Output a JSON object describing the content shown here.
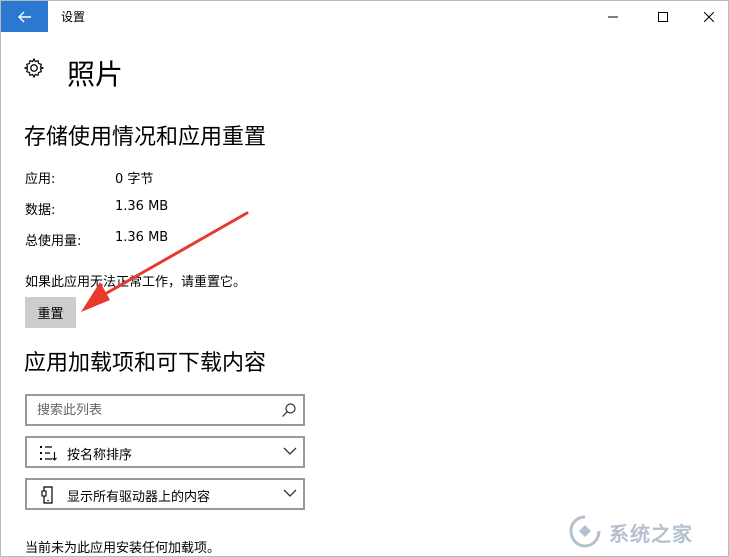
{
  "window": {
    "title": "设置",
    "accent_color": "#2b78d0"
  },
  "page": {
    "title": "照片",
    "icon": "gear-icon"
  },
  "storage": {
    "section_title": "存储使用情况和应用重置",
    "rows": [
      {
        "label": "应用:",
        "value": "0 字节"
      },
      {
        "label": "数据:",
        "value": "1.36 MB"
      },
      {
        "label": "总使用量:",
        "value": "1.36 MB"
      }
    ],
    "hint": "如果此应用无法正常工作，请重置它。",
    "reset_label": "重置"
  },
  "addons": {
    "section_title": "应用加载项和可下载内容",
    "search_placeholder": "搜索此列表",
    "sort_label": "按名称排序",
    "drive_label": "显示所有驱动器上的内容",
    "empty_text": "当前未为此应用安装任何加载项。"
  },
  "annotation": {
    "arrow_color": "#e8392f"
  }
}
